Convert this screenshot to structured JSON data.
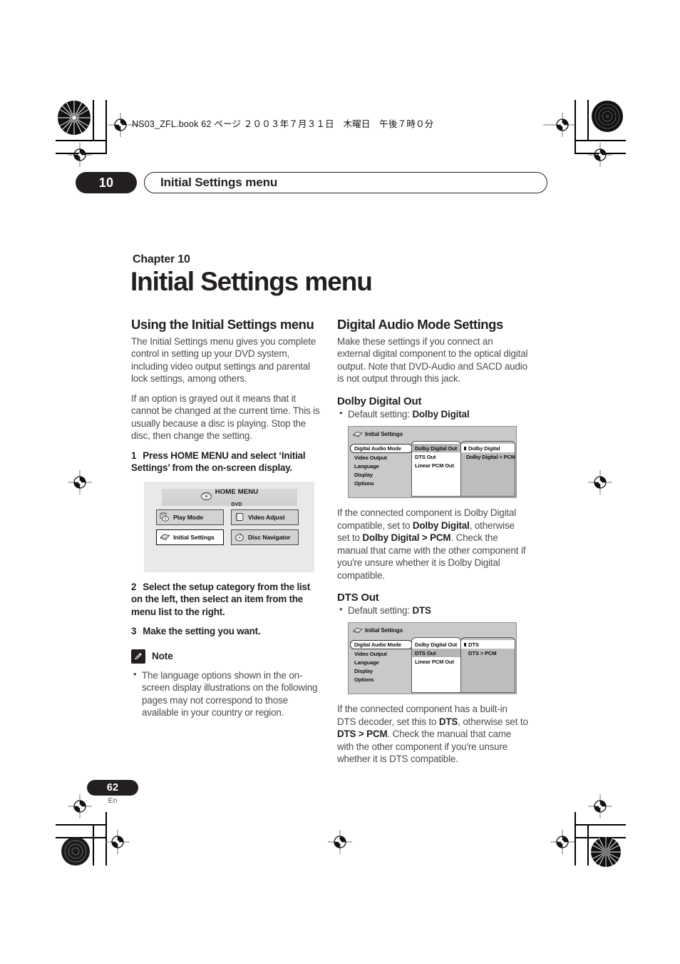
{
  "print_imprint": "NS03_ZFL.book  62 ページ  ２００３年７月３１日　木曜日　午後７時０分",
  "running_header": {
    "chapter_number": "10",
    "title": "Initial Settings menu"
  },
  "chapter": {
    "label": "Chapter 10",
    "title": "Initial Settings menu"
  },
  "left_column": {
    "section_title": "Using the Initial Settings menu",
    "para1": "The Initial Settings menu gives you complete control in setting up your DVD system, including video output settings and parental lock settings, among others.",
    "para2": "If an option is grayed out it means that it cannot be changed at the current time. This is usually because a disc is playing. Stop the disc, then change the setting.",
    "step1_num": "1",
    "step1_text": "Press HOME MENU and select ‘Initial Settings’ from the on-screen display.",
    "step2_num": "2",
    "step2_text": "Select the setup category from the list on the left, then select an item from the menu list to the right.",
    "step3_num": "3",
    "step3_text": "Make the setting you want.",
    "note_title": "Note",
    "note_items": [
      "The language options shown in the on-screen display illustrations on the following pages may not correspond to those available in your country or region."
    ]
  },
  "home_menu_illustration": {
    "title_main": "HOME MENU",
    "title_sub": "DVD",
    "buttons": [
      {
        "label": "Play Mode",
        "icon": "play-mode-icon",
        "selected": false
      },
      {
        "label": "Video Adjust",
        "icon": "video-adjust-icon",
        "selected": false
      },
      {
        "label": "Initial Settings",
        "icon": "initial-settings-icon",
        "selected": true
      },
      {
        "label": "Disc Navigator",
        "icon": "disc-navigator-icon",
        "selected": false
      }
    ]
  },
  "right_column": {
    "section_title": "Digital Audio Mode Settings",
    "intro": "Make these settings if you connect an external digital component to the optical digital output. Note that DVD-Audio and SACD audio is not output through this jack.",
    "dolby": {
      "heading": "Dolby Digital Out",
      "default_prefix": "Default setting: ",
      "default_value": "Dolby Digital",
      "body_1": "If the connected component is Dolby Digital compatible, set to ",
      "body_b1": "Dolby Digital",
      "body_2": ", otherwise set to ",
      "body_b2": "Dolby Digital > PCM",
      "body_3": ". Check the manual that came with the other component if you're unsure whether it is Dolby Digital compatible."
    },
    "dts": {
      "heading": "DTS Out",
      "default_prefix": "Default setting: ",
      "default_value": "DTS",
      "body_1": "If the connected component has a built-in DTS decoder, set this to ",
      "body_b1": "DTS",
      "body_2": ", otherwise set to ",
      "body_b2": "DTS > PCM",
      "body_3": ". Check the manual that came with the other component if you're unsure whether it is DTS compatible."
    }
  },
  "osd_dolby": {
    "header": "Initial Settings",
    "categories": [
      "Digital Audio Mode",
      "Video Output",
      "Language",
      "Display",
      "Options"
    ],
    "category_selected": "Digital Audio Mode",
    "items": [
      "Dolby Digital Out",
      "DTS Out",
      "Linear PCM Out"
    ],
    "item_selected": "Dolby Digital Out",
    "options": [
      "Dolby Digital",
      "Dolby Digital > PCM"
    ],
    "option_selected": "Dolby Digital"
  },
  "osd_dts": {
    "header": "Initial Settings",
    "categories": [
      "Digital Audio Mode",
      "Video Output",
      "Language",
      "Display",
      "Options"
    ],
    "category_selected": "Digital Audio Mode",
    "items": [
      "Dolby Digital Out",
      "DTS Out",
      "Linear PCM Out"
    ],
    "item_selected": "DTS Out",
    "options": [
      "DTS",
      "DTS > PCM"
    ],
    "option_selected": "DTS"
  },
  "footer": {
    "page_number": "62",
    "language_code": "En"
  },
  "colors": {
    "ink": "#231f20",
    "body_text": "#4b4b4d",
    "illustration_bg": "#e9e9e9",
    "osd_bg": "#c9c9c9"
  }
}
